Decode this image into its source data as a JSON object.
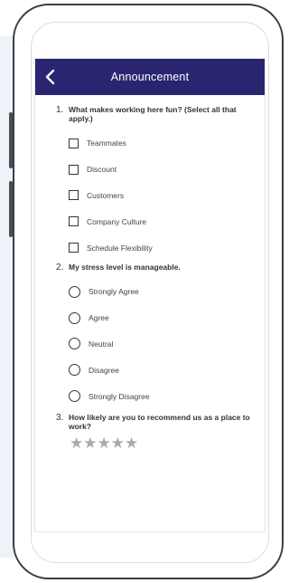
{
  "appbar": {
    "title": "Announcement",
    "back_icon": "chevron-left-icon",
    "color": "#2a2570"
  },
  "questions": [
    {
      "number": "1.",
      "text": "What makes working here fun? (Select all that apply.)",
      "type": "checkbox",
      "options": [
        "Teammates",
        "Discount",
        "Customers",
        "Company Culture",
        "Schedule Flexibility"
      ]
    },
    {
      "number": "2.",
      "text": "My stress level is manageable.",
      "type": "radio",
      "options": [
        "Strongly Agree",
        "Agree",
        "Neutral",
        "Disagree",
        "Strongly Disagree"
      ]
    },
    {
      "number": "3.",
      "text": "How likely are you to recommend us as a place to work?",
      "type": "rating",
      "max_stars": 5,
      "rating": 0,
      "star_color": "#a9a9ad"
    }
  ]
}
